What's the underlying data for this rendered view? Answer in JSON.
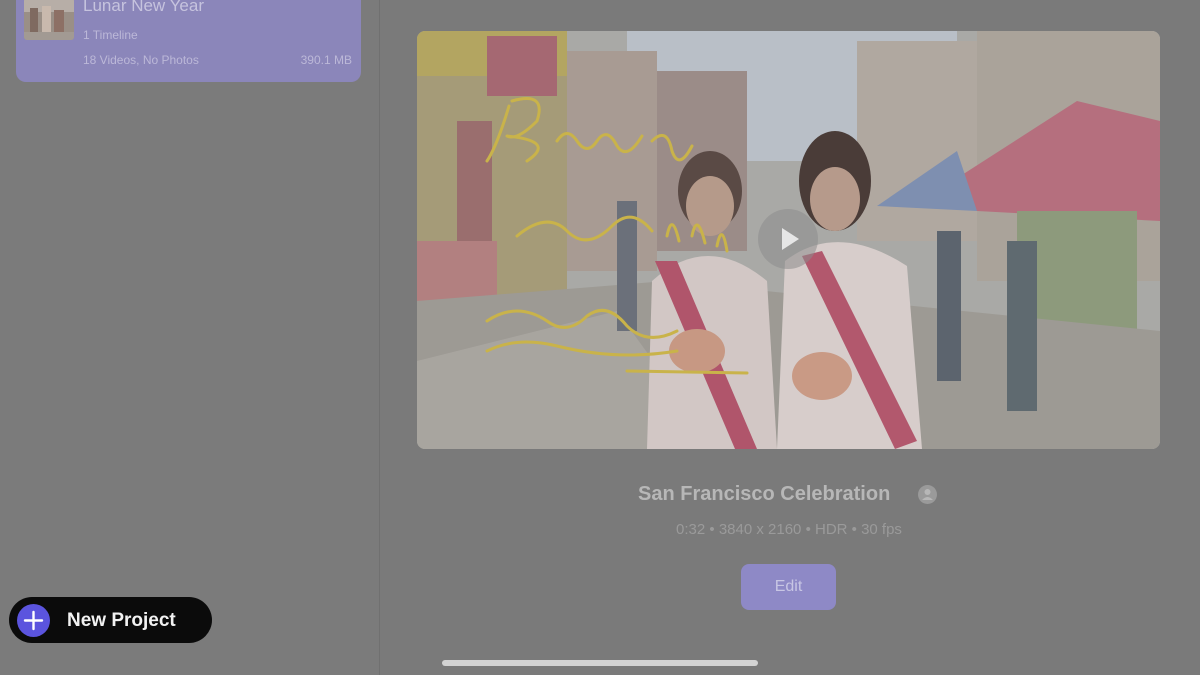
{
  "sidebar": {
    "project": {
      "title": "Lunar New Year",
      "timelines": "1 Timeline",
      "contents": "18 Videos, No Photos",
      "size": "390.1 MB",
      "thumbnail_icon": "lunar-new-year-thumbnail"
    },
    "new_project": {
      "label": "New Project",
      "icon": "plus-icon",
      "accent": "#5b54de"
    }
  },
  "main": {
    "preview": {
      "play_icon": "play-icon"
    },
    "video": {
      "title": "San Francisco Celebration",
      "title_icon": "info-icon",
      "meta": "0:32 • 3840 x 2160 • HDR • 30 fps"
    },
    "edit_button": {
      "label": "Edit",
      "color": "#8e89c6"
    }
  },
  "colors": {
    "overlay_background": "#7a7a7a",
    "project_card": "#8b86ba"
  }
}
